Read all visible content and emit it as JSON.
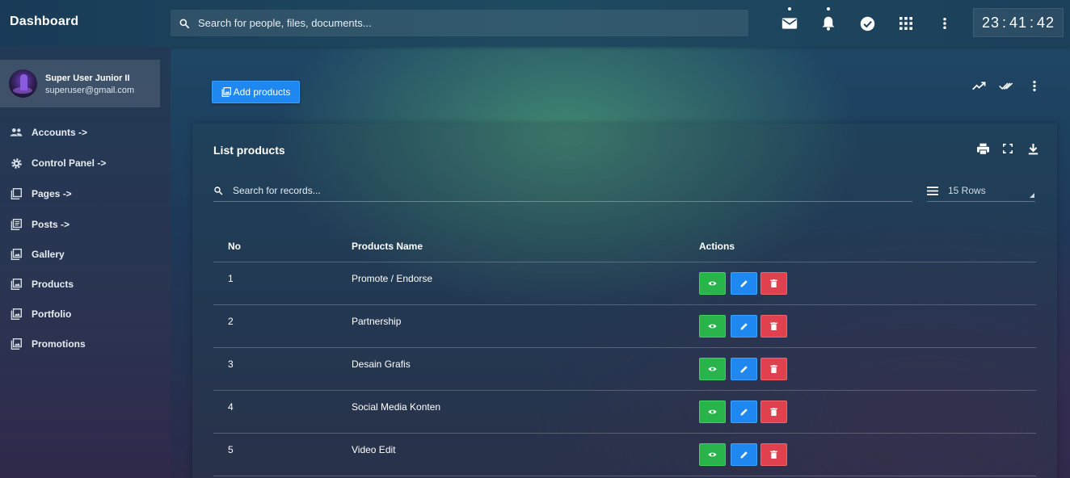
{
  "header": {
    "brand": "Dashboard",
    "search_placeholder": "Search for people, files, documents...",
    "clock": {
      "h": "23",
      "m": "41",
      "s": "42"
    },
    "icons": [
      "mail-icon",
      "bell-icon",
      "check-circle-icon",
      "apps-grid-icon",
      "more-vert-icon"
    ]
  },
  "sidebar": {
    "user_name": "Super User Junior II",
    "user_email": "superuser@gmail.com",
    "items": [
      {
        "label": "Accounts ->",
        "icon": "people-icon"
      },
      {
        "label": "Control Panel ->",
        "icon": "gear-icon"
      },
      {
        "label": "Pages ->",
        "icon": "pages-icon"
      },
      {
        "label": "Posts ->",
        "icon": "posts-icon"
      },
      {
        "label": "Gallery",
        "icon": "image-icon"
      },
      {
        "label": "Products",
        "icon": "image-icon"
      },
      {
        "label": "Portfolio",
        "icon": "image-icon"
      },
      {
        "label": "Promotions",
        "icon": "image-icon"
      }
    ]
  },
  "main": {
    "add_button": "Add products",
    "page_tool_icons": [
      "trending-up-icon",
      "double-check-icon",
      "more-vert-icon"
    ],
    "card": {
      "title": "List products",
      "tool_icons": [
        "print-icon",
        "fullscreen-icon",
        "download-icon"
      ],
      "search_placeholder": "Search for records...",
      "rows_select": "15 Rows",
      "columns": [
        "No",
        "Products Name",
        "Actions"
      ],
      "rows": [
        {
          "no": "1",
          "name": "Promote / Endorse"
        },
        {
          "no": "2",
          "name": "Partnership"
        },
        {
          "no": "3",
          "name": "Desain Grafis"
        },
        {
          "no": "4",
          "name": "Social Media Konten"
        },
        {
          "no": "5",
          "name": "Video Edit"
        }
      ]
    }
  },
  "colors": {
    "view": "#28b44a",
    "edit": "#1e88f0",
    "delete": "#e0414e",
    "primary": "#1e88f0"
  }
}
